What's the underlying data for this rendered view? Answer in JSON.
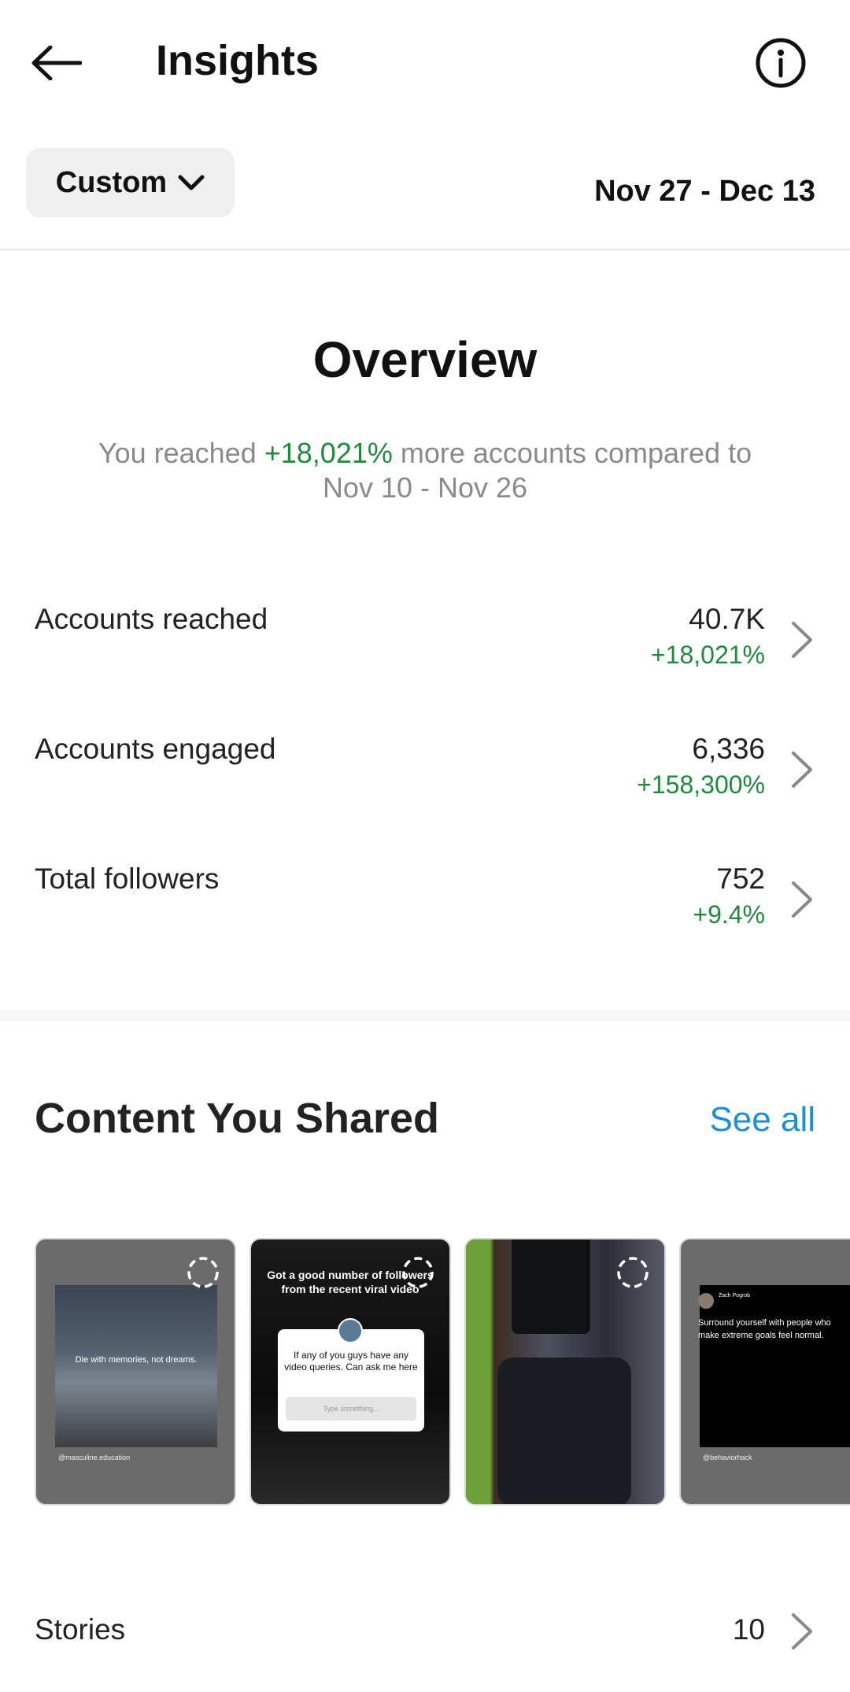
{
  "header": {
    "title": "Insights",
    "back_icon": "arrow-left-icon",
    "info_icon": "info-circle-icon"
  },
  "filter": {
    "custom_label": "Custom",
    "date_range": "Nov 27 - Dec 13"
  },
  "overview": {
    "title": "Overview",
    "summary_prefix": "You reached ",
    "summary_change": "+18,021%",
    "summary_suffix": " more accounts compared to",
    "summary_period": "Nov 10 - Nov 26",
    "metrics": [
      {
        "label": "Accounts reached",
        "value": "40.7K",
        "change": "+18,021%"
      },
      {
        "label": "Accounts engaged",
        "value": "6,336",
        "change": "+158,300%"
      },
      {
        "label": "Total followers",
        "value": "752",
        "change": "+9.4%"
      }
    ]
  },
  "content": {
    "title": "Content You Shared",
    "see_all": "See all",
    "thumbnails": [
      {
        "text": "Die with memories, not dreams.",
        "handle": "@masculine.education"
      },
      {
        "heading": "Got a good number of followers from the recent viral video",
        "question": "If any of you guys have any video queries. Can ask me here",
        "placeholder": "Type something..."
      },
      {
        "image": "camera-photo"
      },
      {
        "name": "Zach Pogrob",
        "text": "Surround yourself with people who make extreme goals feel normal.",
        "handle": "@behaviorhack"
      }
    ]
  },
  "stories": {
    "label": "Stories",
    "count": "10"
  },
  "colors": {
    "positive": "#1f8a3b",
    "link": "#1d8fd6",
    "muted": "#8a8a8a"
  }
}
